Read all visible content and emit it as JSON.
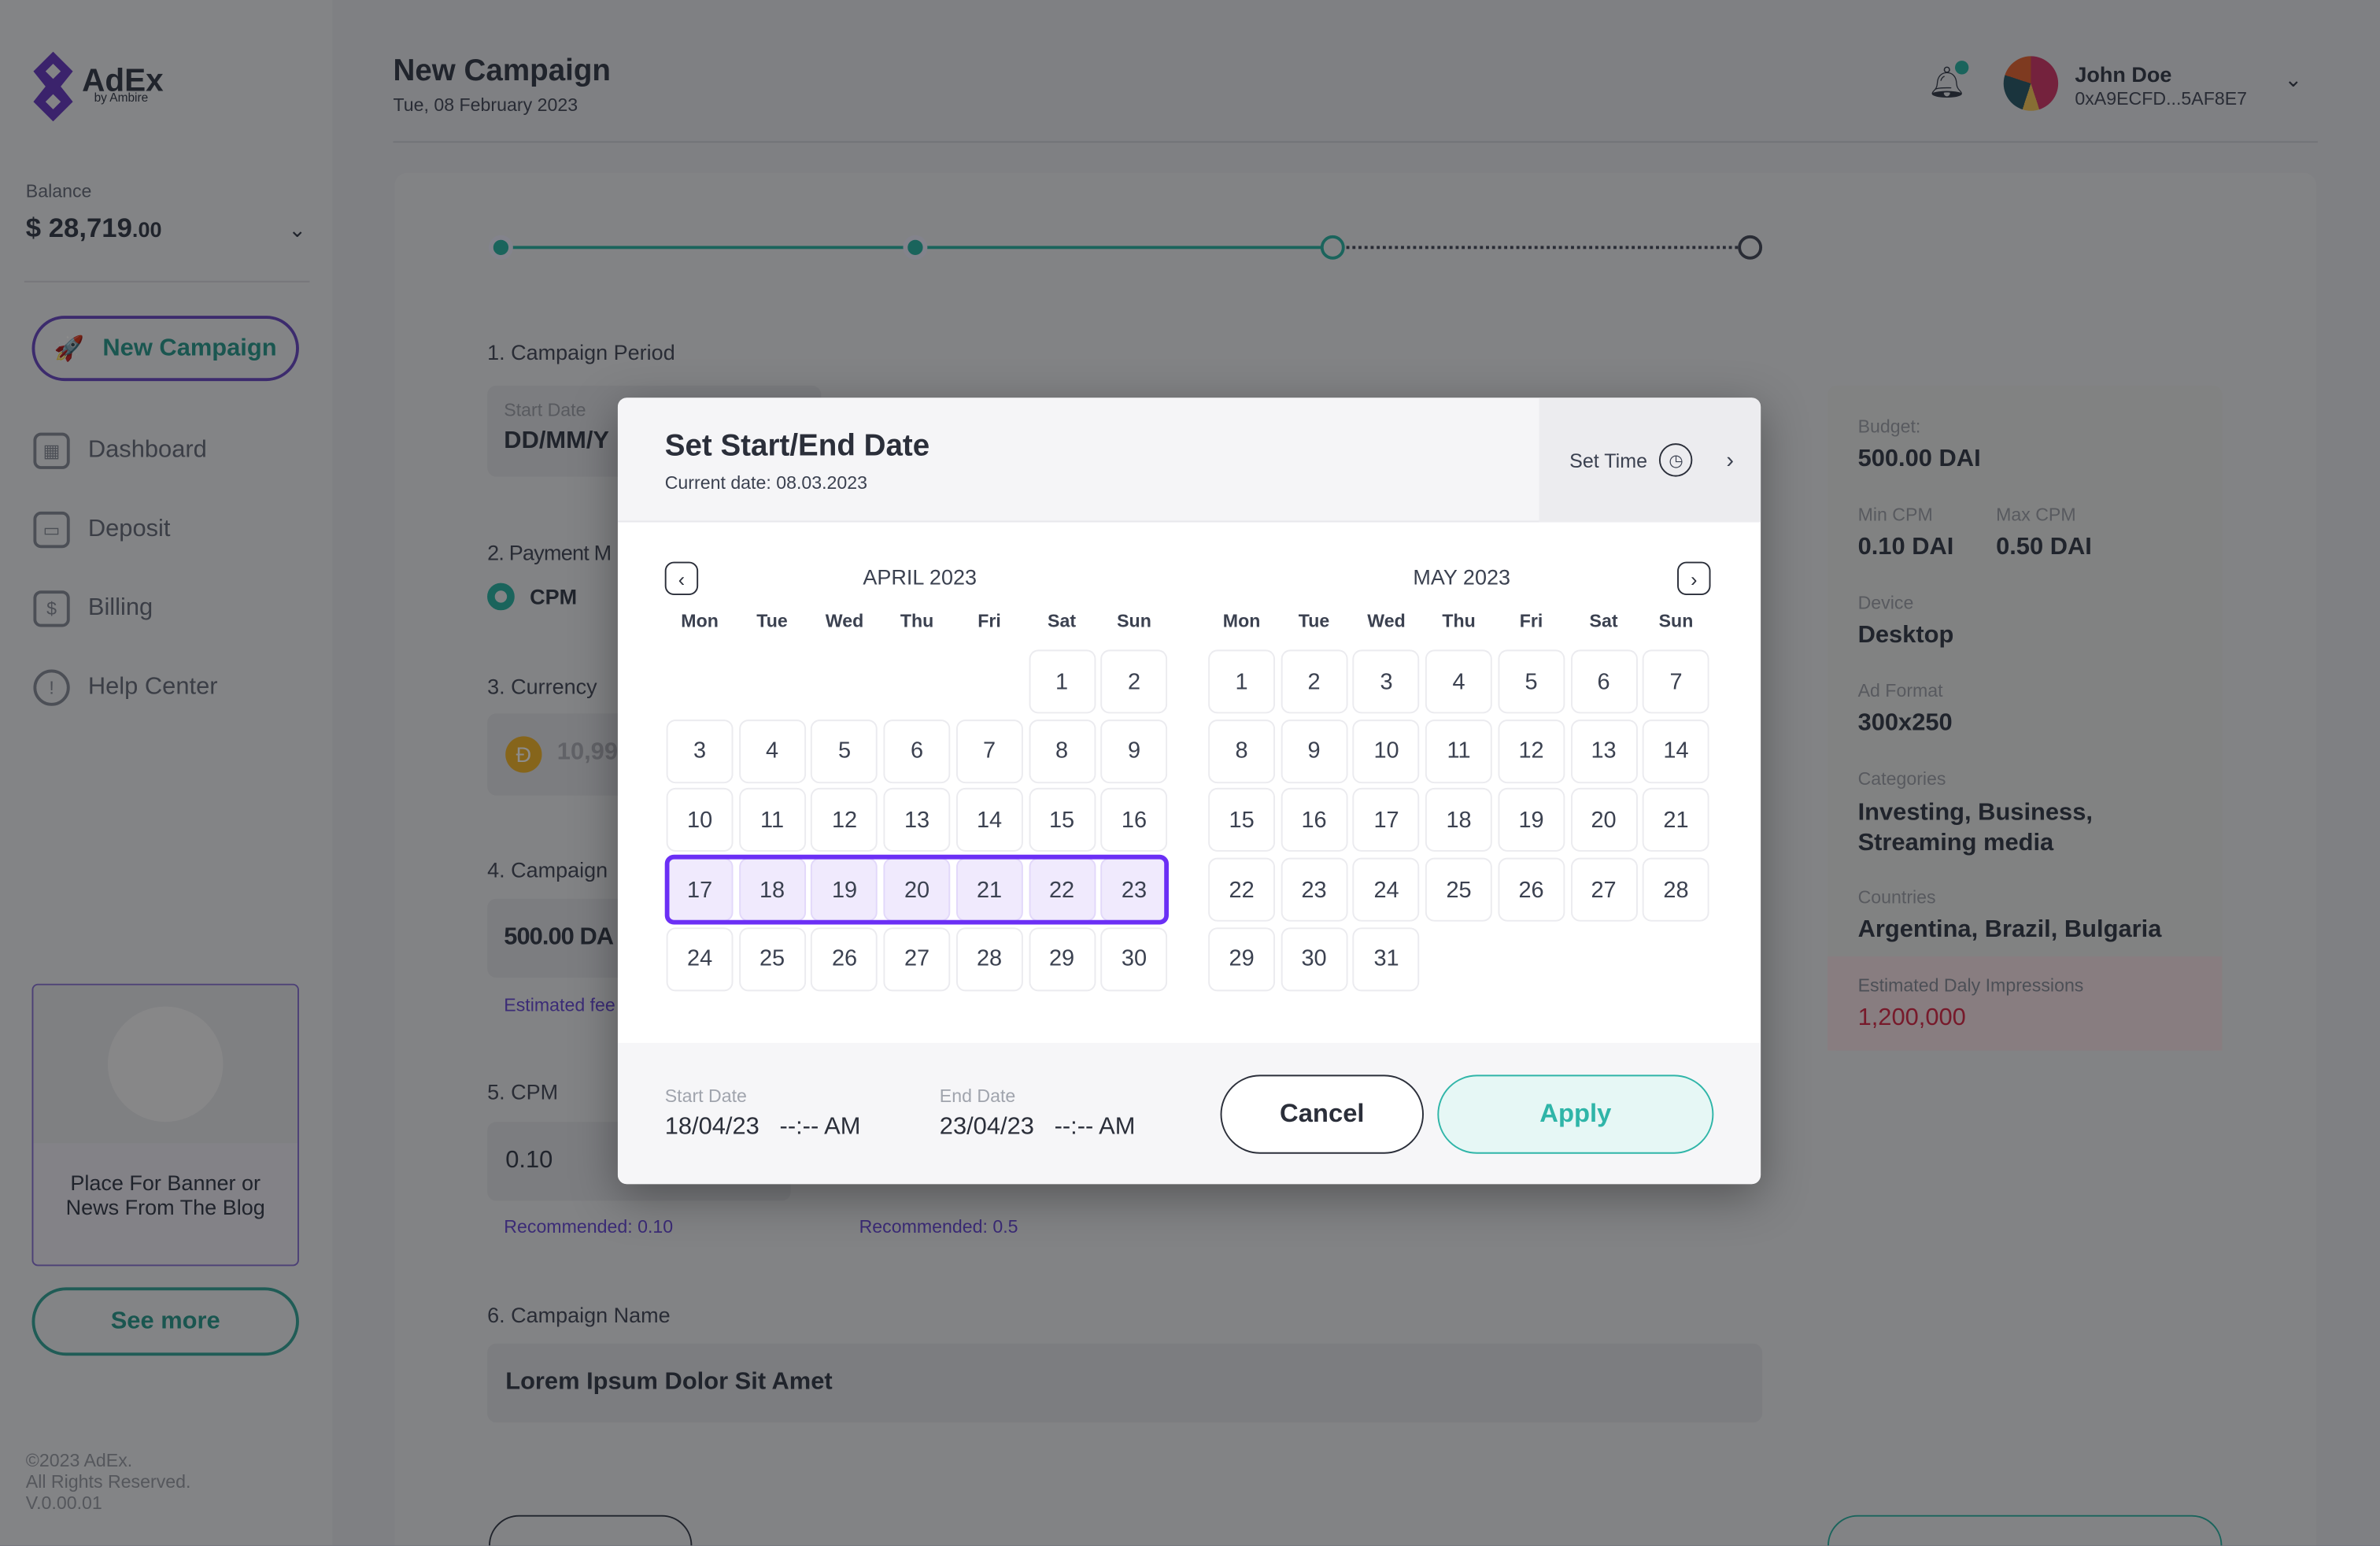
{
  "brand": {
    "name": "AdEx",
    "sub": "by Ambire"
  },
  "sidebar": {
    "balance_label": "Balance",
    "balance_main": "$ 28,719",
    "balance_cents": ".00",
    "new_campaign": "New Campaign",
    "items": [
      {
        "label": "Dashboard",
        "icon": "grid-icon"
      },
      {
        "label": "Deposit",
        "icon": "wallet-icon"
      },
      {
        "label": "Billing",
        "icon": "dollar-icon"
      },
      {
        "label": "Help Center",
        "icon": "lightbulb-icon"
      }
    ],
    "banner_text": "Place For Banner or News From The Blog",
    "see_more": "See more",
    "footer": [
      "©2023 AdEx.",
      "All Rights Reserved.",
      "V.0.00.01"
    ]
  },
  "header": {
    "title": "New Campaign",
    "date": "Tue, 08 February 2023",
    "user_name": "John Doe",
    "user_address": "0xA9ECFD...5AF8E7"
  },
  "form": {
    "s1": "1. Campaign Period",
    "start_label": "Start Date",
    "start_value": "DD/MM/Y",
    "s2": "2. Payment M",
    "payment": "CPM",
    "s3": "3. Currency",
    "currency_value": "10,99",
    "s4": "4. Campaign",
    "budget_value": "500.00 DA",
    "estimated": "Estimated fee",
    "s5": "5. CPM",
    "cpm_value": "0.10",
    "rec_min": "Recommended: 0.10",
    "rec_max": "Recommended: 0.5",
    "s6": "6. Campaign Name",
    "name_value": "Lorem Ipsum Dolor Sit Amet"
  },
  "summary": {
    "budget_label": "Budget:",
    "budget": "500.00 DAI",
    "min_cpm_label": "Min CPM",
    "min_cpm": "0.10 DAI",
    "max_cpm_label": "Max CPM",
    "max_cpm": "0.50 DAI",
    "device_label": "Device",
    "device": "Desktop",
    "format_label": "Ad Format",
    "format": "300x250",
    "categories_label": "Categories",
    "categories": "Investing, Business, Streaming media",
    "countries_label": "Countries",
    "countries": "Argentina, Brazil, Bulgaria",
    "impressions_label": "Estimated Daly Impressions",
    "impressions": "1,200,000"
  },
  "stepper": {
    "steps": 4,
    "completed": 2,
    "current": 3
  },
  "modal": {
    "title": "Set Start/End Date",
    "current_date": "Current date: 08.03.2023",
    "set_time": "Set Time",
    "weekdays": [
      "Mon",
      "Tue",
      "Wed",
      "Thu",
      "Fri",
      "Sat",
      "Sun"
    ],
    "months": [
      {
        "title": "APRIL 2023",
        "weeks": [
          [
            null,
            null,
            null,
            null,
            null,
            1,
            2
          ],
          [
            3,
            4,
            5,
            6,
            7,
            8,
            9
          ],
          [
            10,
            11,
            12,
            13,
            14,
            15,
            16
          ],
          [
            17,
            18,
            19,
            20,
            21,
            22,
            23
          ],
          [
            24,
            25,
            26,
            27,
            28,
            29,
            30
          ]
        ],
        "selected": [
          17,
          23
        ]
      },
      {
        "title": "MAY 2023",
        "weeks": [
          [
            1,
            2,
            3,
            4,
            5,
            6,
            7
          ],
          [
            8,
            9,
            10,
            11,
            12,
            13,
            14
          ],
          [
            15,
            16,
            17,
            18,
            19,
            20,
            21
          ],
          [
            22,
            23,
            24,
            25,
            26,
            27,
            28
          ],
          [
            29,
            30,
            31,
            null,
            null,
            null,
            null
          ]
        ],
        "selected": null
      }
    ],
    "start_label": "Start Date",
    "start_date": "18/04/23",
    "start_time": "--:-- AM",
    "end_label": "End Date",
    "end_date": "23/04/23",
    "end_time": "--:-- AM",
    "cancel": "Cancel",
    "apply": "Apply"
  },
  "colors": {
    "accent": "#2fb5a8",
    "selection": "#6b2ff5",
    "danger": "#d9304f"
  }
}
